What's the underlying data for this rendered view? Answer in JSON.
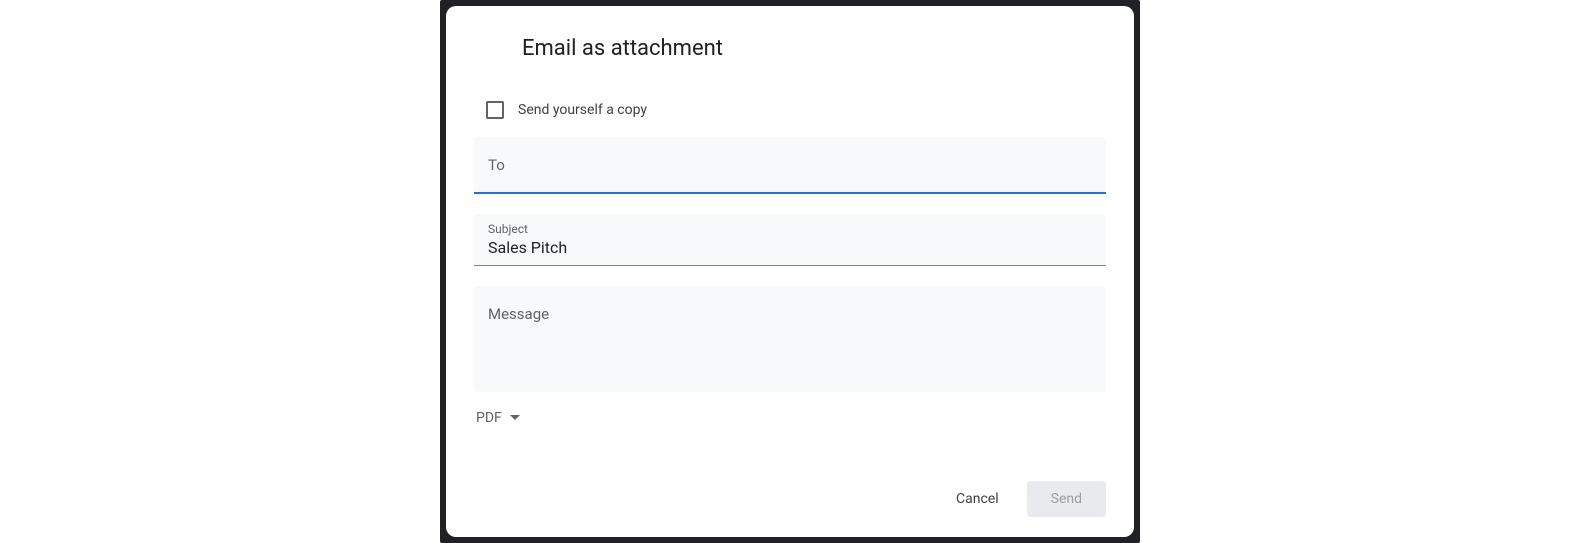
{
  "dialog": {
    "title": "Email as attachment",
    "send_copy_label": "Send yourself a copy",
    "send_copy_checked": false,
    "to": {
      "label": "To",
      "value": ""
    },
    "subject": {
      "label": "Subject",
      "value": "Sales Pitch"
    },
    "message": {
      "placeholder": "Message",
      "value": ""
    },
    "format": {
      "selected": "PDF"
    },
    "buttons": {
      "cancel": "Cancel",
      "send": "Send"
    }
  }
}
